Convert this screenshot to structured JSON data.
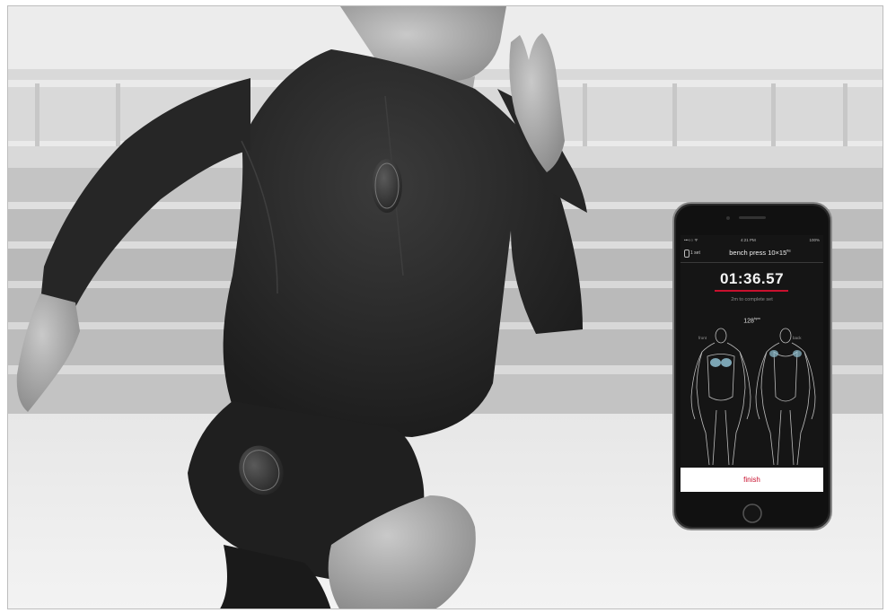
{
  "photo": {
    "subject": "sprinting-athlete",
    "description_icon": "smart-compression-shirt-sensors"
  },
  "phone": {
    "status_bar": {
      "carrier": "•••○○ ᯤ",
      "time": "4:21 PM",
      "battery": "100%"
    },
    "set_count": "1 set",
    "exercise_title": "bench press 10×15",
    "exercise_unit": "lbs",
    "timer": "01:36.57",
    "subtext": "2m to complete set",
    "heart_rate": "128",
    "heart_rate_unit": "bpm",
    "label_front": "front",
    "label_back": "back",
    "finish_label": "finish",
    "accent_color": "#c8102e"
  }
}
